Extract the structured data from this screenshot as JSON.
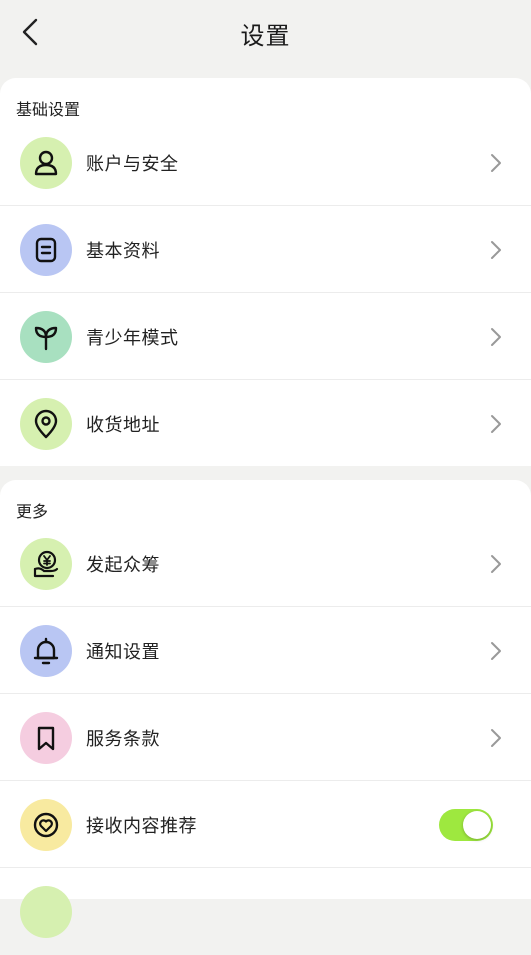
{
  "header": {
    "title": "设置"
  },
  "sections": [
    {
      "title": "基础设置",
      "items": [
        {
          "label": "账户与安全",
          "icon": "user-icon",
          "icon_bg": "#d6f0b0"
        },
        {
          "label": "基本资料",
          "icon": "document-icon",
          "icon_bg": "#b9c6f3"
        },
        {
          "label": "青少年模式",
          "icon": "sprout-icon",
          "icon_bg": "#a8e0c0"
        },
        {
          "label": "收货地址",
          "icon": "location-pin-icon",
          "icon_bg": "#d6f0b0"
        }
      ]
    },
    {
      "title": "更多",
      "items": [
        {
          "label": "发起众筹",
          "icon": "yuan-hand-icon",
          "icon_bg": "#d6f0b0"
        },
        {
          "label": "通知设置",
          "icon": "bell-icon",
          "icon_bg": "#b9c6f3"
        },
        {
          "label": "服务条款",
          "icon": "bookmark-icon",
          "icon_bg": "#f5cde0"
        },
        {
          "label": "接收内容推荐",
          "icon": "heart-icon",
          "icon_bg": "#f8eaa0",
          "toggle": true,
          "toggle_on": true
        }
      ]
    }
  ],
  "colors": {
    "toggle_on": "#9ee83f",
    "divider": "#ececec",
    "page_bg": "#f2f2f0"
  }
}
